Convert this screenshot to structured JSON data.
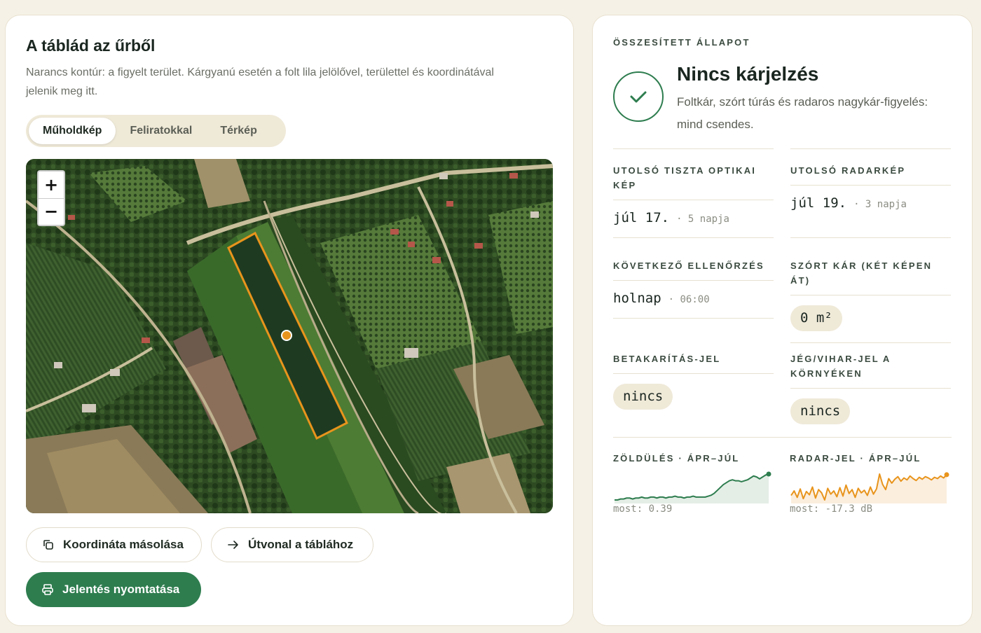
{
  "map_panel": {
    "title": "A táblád az űrből",
    "description": "Narancs kontúr: a figyelt terület. Kárgyanú esetén a folt lila jelölővel, területtel és koordinátával jelenik meg itt.",
    "view_tabs": [
      {
        "label": "Műholdkép",
        "active": true
      },
      {
        "label": "Feliratokkal",
        "active": false
      },
      {
        "label": "Térkép",
        "active": false
      }
    ],
    "zoom_in": "+",
    "zoom_out": "−",
    "field_outline_color": "#e8941c",
    "buttons": {
      "copy_coords": "Koordináta másolása",
      "route": "Útvonal a táblához",
      "print_report": "Jelentés nyomtatása"
    }
  },
  "status_panel": {
    "eyebrow": "Összesített állapot",
    "title": "Nincs kárjelzés",
    "subtitle": "Foltkár, szórt túrás és radaros nagykár-figyelés: mind csendes.",
    "status_color": "#2e7d4f",
    "last_optical": {
      "label": "Utolsó tiszta optikai kép",
      "value": "júl 17.",
      "age": "· 5 napja"
    },
    "last_radar": {
      "label": "Utolsó radarkép",
      "value": "júl 19.",
      "age": "· 3 napja"
    },
    "next_check": {
      "label": "Következő ellenőrzés",
      "value": "holnap",
      "time": "· 06:00"
    },
    "scattered_damage": {
      "label": "Szórt kár (két képen át)",
      "value": "0 m²"
    },
    "harvest_signal": {
      "label": "Betakarítás-jel",
      "value": "nincs"
    },
    "hail_signal": {
      "label": "Jég/vihar-jel a környéken",
      "value": "nincs"
    },
    "greening": {
      "label": "Zöldülés · ápr–júl",
      "caption": "most: 0.39",
      "color": "#2e7d4f"
    },
    "radar": {
      "label": "Radar-jel · ápr–júl",
      "caption": "most: -17.3 dB",
      "color": "#e8941c"
    }
  },
  "chart_data": [
    {
      "type": "area",
      "title": "Zöldülés · ápr–júl",
      "values": [
        0.12,
        0.12,
        0.13,
        0.13,
        0.14,
        0.14,
        0.13,
        0.14,
        0.14,
        0.15,
        0.14,
        0.14,
        0.15,
        0.15,
        0.14,
        0.15,
        0.15,
        0.14,
        0.15,
        0.15,
        0.16,
        0.15,
        0.15,
        0.14,
        0.15,
        0.15,
        0.16,
        0.15,
        0.15,
        0.15,
        0.15,
        0.16,
        0.17,
        0.19,
        0.22,
        0.25,
        0.28,
        0.3,
        0.32,
        0.33,
        0.32,
        0.32,
        0.31,
        0.32,
        0.33,
        0.35,
        0.37,
        0.36,
        0.34,
        0.36,
        0.38,
        0.39
      ],
      "last": 0.39
    },
    {
      "type": "area",
      "title": "Radar-jel · ápr–júl",
      "values": [
        -20.5,
        -19.8,
        -20.8,
        -19.5,
        -21.0,
        -19.9,
        -20.4,
        -19.2,
        -20.9,
        -19.6,
        -20.1,
        -21.2,
        -19.4,
        -20.3,
        -19.8,
        -20.7,
        -19.3,
        -20.6,
        -18.9,
        -20.2,
        -19.6,
        -20.8,
        -19.4,
        -20.1,
        -19.7,
        -20.5,
        -19.2,
        -20.3,
        -19.5,
        -17.2,
        -18.8,
        -19.6,
        -17.9,
        -18.6,
        -18.0,
        -17.6,
        -18.3,
        -17.8,
        -18.1,
        -17.5,
        -17.9,
        -18.2,
        -17.7,
        -18.0,
        -17.6,
        -17.8,
        -18.1,
        -17.7,
        -17.9,
        -17.5,
        -17.8,
        -17.3
      ],
      "last": -17.3,
      "unit": "dB"
    }
  ]
}
